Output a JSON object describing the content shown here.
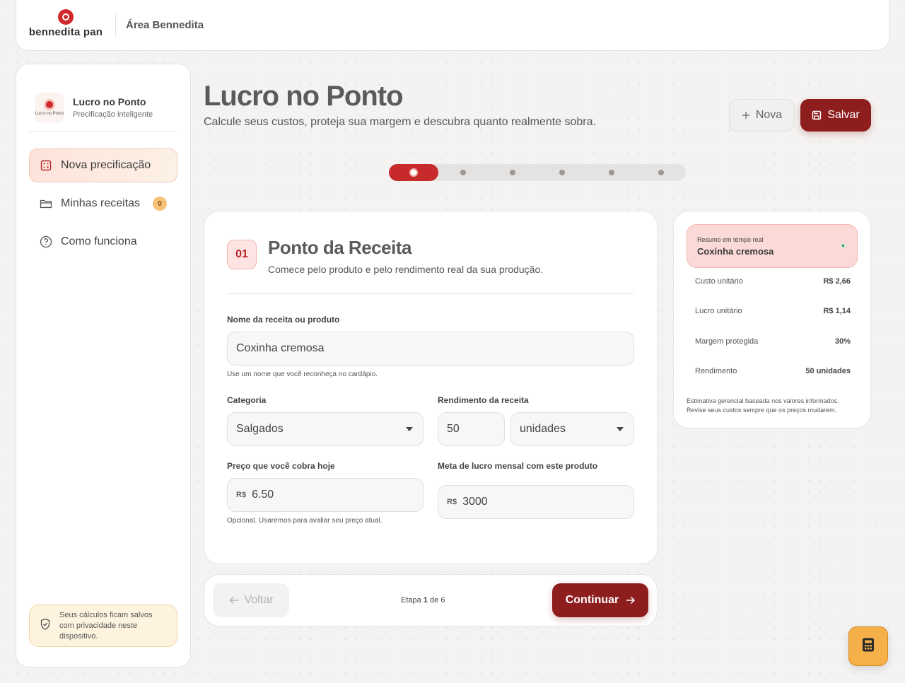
{
  "topbar": {
    "brand": "bennedita pan",
    "area_title": "Área Bennedita"
  },
  "sidebar": {
    "app_title": "Lucro no Ponto",
    "app_subtitle": "Precificação inteligente",
    "logo_text": "Lucro no Ponto",
    "items": [
      {
        "label": "Nova precificação",
        "icon": "calculator-icon",
        "active": true
      },
      {
        "label": "Minhas receitas",
        "icon": "folder-icon",
        "badge": "0"
      },
      {
        "label": "Como funciona",
        "icon": "help-circle-icon"
      }
    ],
    "privacy_note": "Seus cálculos ficam salvos com privacidade neste dispositivo."
  },
  "header": {
    "title": "Lucro no Ponto",
    "subtitle": "Calcule seus custos, proteja sua margem e descubra quanto realmente sobra.",
    "nova_label": "Nova",
    "salvar_label": "Salvar"
  },
  "progress": {
    "current_step": 1,
    "total_steps": 6
  },
  "form": {
    "step_number": "01",
    "title": "Ponto da Receita",
    "subtitle": "Comece pelo produto e pelo rendimento real da sua produção.",
    "recipe_name_label": "Nome da receita ou produto",
    "recipe_name_value": "Coxinha cremosa",
    "recipe_name_hint": "Use um nome que você reconheça no cardápio.",
    "category_label": "Categoria",
    "category_value": "Salgados",
    "yield_label": "Rendimento da receita",
    "yield_value": "50",
    "yield_unit": "unidades",
    "price_label": "Preço que você cobra hoje",
    "price_prefix": "R$",
    "price_value": "6.50",
    "price_hint": "Opcional. Usaremos para avaliar seu preço atual.",
    "goal_label": "Meta de lucro mensal com este produto",
    "goal_prefix": "R$",
    "goal_value": "3000"
  },
  "bottom_nav": {
    "back_label": "Voltar",
    "step_prefix": "Etapa",
    "step_current": "1",
    "step_sep": "de",
    "step_total": "6",
    "continue_label": "Continuar"
  },
  "summary": {
    "caption": "Resumo em tempo real",
    "product": "Coxinha cremosa",
    "rows": [
      {
        "label": "Custo unitário",
        "value": "R$ 2,66"
      },
      {
        "label": "Lucro unitário",
        "value": "R$ 1,14"
      },
      {
        "label": "Margem protegida",
        "value": "30%"
      },
      {
        "label": "Rendimento",
        "value": "50 unidades"
      }
    ],
    "note": "Estimativa gerencial baseada nos valores informados. Revise seus custos sempre que os preços mudarem."
  },
  "colors": {
    "primary": "#8e1d1d",
    "accent_red": "#c72a2a",
    "fab": "#f6b04a",
    "status_dot": "#1a8a4a"
  }
}
